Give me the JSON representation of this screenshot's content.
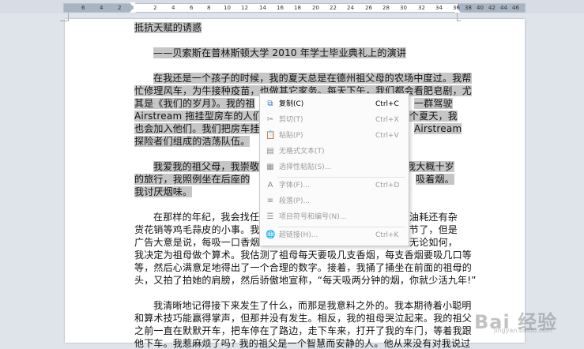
{
  "ruler": {
    "left_numbers": [
      "6",
      "4",
      "2"
    ],
    "numbers": [
      "2",
      "4",
      "6",
      "8",
      "10",
      "12",
      "14",
      "16",
      "18",
      "20",
      "22",
      "24",
      "26",
      "28",
      "30",
      "32",
      "34",
      "36",
      "38",
      "40",
      "42",
      "44",
      "46"
    ]
  },
  "document": {
    "lines": [
      {
        "text": "抵抗天赋的诱惑",
        "selected": true
      },
      {
        "text": "——贝索斯在普林斯顿大学 2010 年学士毕业典礼上的演讲",
        "selected": true
      },
      {
        "text": "在我还是一个孩子的时候，我的夏天总是在德州祖父母的农场中度过。我帮",
        "selected": true
      },
      {
        "text": "忙修理风车，为牛接种疫苗，也做其它家务。每天下午，我们都会看肥皂剧，尤",
        "selected": true
      },
      {
        "text": "其是《我们的岁月》。我的祖",
        "tail": "一群驾驶",
        "selected": true
      },
      {
        "text": "Airstream 拖挂型房车的人们,",
        "tail": "个夏天，我",
        "selected": true
      },
      {
        "text": "也会加入他们。我们把房车挂在",
        "tail": "Airstream",
        "selected": true
      },
      {
        "text": "探险者们组成的浩荡队伍。",
        "selected": true
      },
      {
        "text": "我爱我的祖父母，我崇敬他",
        "tail": "我大概十岁",
        "selected": true
      },
      {
        "text": "的旅行，我照例坐在后座的",
        "tail": "吸着烟。",
        "selected": true
      },
      {
        "text": "我讨厌烟味。",
        "selected": true
      },
      {
        "text": "在那样的年纪，我会找任何",
        "tail": "油耗还有杂",
        "selected": false
      },
      {
        "text": "货花销等鸡毛蒜皮的小事。我听",
        "tail": "节了，但是",
        "selected": false
      },
      {
        "text": "广告大意是说，每吸一口香烟会",
        "tail": "无论如何，",
        "selected": false
      },
      {
        "text": "我决定为祖母做个算术。我估测了祖母每天要吸几支香烟，每支香烟要吸几口等",
        "selected": false
      },
      {
        "text": "等，然后心满意足地得出了一个合理的数字。接着，我捅了捅坐在前面的祖母的",
        "selected": false
      },
      {
        "text": "头，又拍了拍她的肩膀，然后骄傲地宣称，“每天吸两分钟的烟，你就少活九年!”",
        "selected": false
      },
      {
        "text": "我清晰地记得接下来发生了什么，而那是我意料之外的。我本期待着小聪明",
        "selected": false
      },
      {
        "text": "和算术技巧能赢得掌声，但那并没有发生。相反，我的祖母哭泣起来。我的祖父",
        "selected": false
      },
      {
        "text": "之前一直在默默开车，把车停在了路边，走下车来，打开了我的车门，等着我跟",
        "selected": false
      },
      {
        "text": "他下车。我惹麻烦了吗? 我的祖父是一个智慧而安静的人。他从来没有对我说过",
        "selected": false
      }
    ]
  },
  "context_menu": {
    "items": [
      {
        "icon": "copy-icon",
        "glyph": "⧉",
        "label": "复制(C)",
        "shortcut": "Ctrl+C",
        "enabled": true
      },
      {
        "icon": "cut-icon",
        "glyph": "✂",
        "label": "剪切(T)",
        "shortcut": "Ctrl+X",
        "enabled": false
      },
      {
        "icon": "paste-icon",
        "glyph": "📋",
        "label": "粘贴(P)",
        "shortcut": "Ctrl+V",
        "enabled": false
      },
      {
        "icon": "paste-plain-text-icon",
        "glyph": "▤",
        "label": "无格式文本(T)",
        "shortcut": "",
        "enabled": false
      },
      {
        "icon": "paste-special-icon",
        "glyph": "▦",
        "label": "选择性粘贴(S)...",
        "shortcut": "",
        "enabled": false
      },
      {
        "icon": "font-icon",
        "glyph": "A",
        "label": "字体(F)...",
        "shortcut": "Ctrl+D",
        "enabled": false
      },
      {
        "icon": "paragraph-icon",
        "glyph": "≡",
        "label": "段落(P)...",
        "shortcut": "",
        "enabled": false
      },
      {
        "icon": "bullets-numbering-icon",
        "glyph": "☰",
        "label": "项目符号和编号(N)...",
        "shortcut": "",
        "enabled": false
      },
      {
        "icon": "hyperlink-icon",
        "glyph": "🌐",
        "label": "超链接(H)...",
        "shortcut": "Ctrl+K",
        "enabled": false
      }
    ]
  },
  "watermark": {
    "text": "Bai 经验",
    "subtext": "jingyan.baidu.com"
  }
}
